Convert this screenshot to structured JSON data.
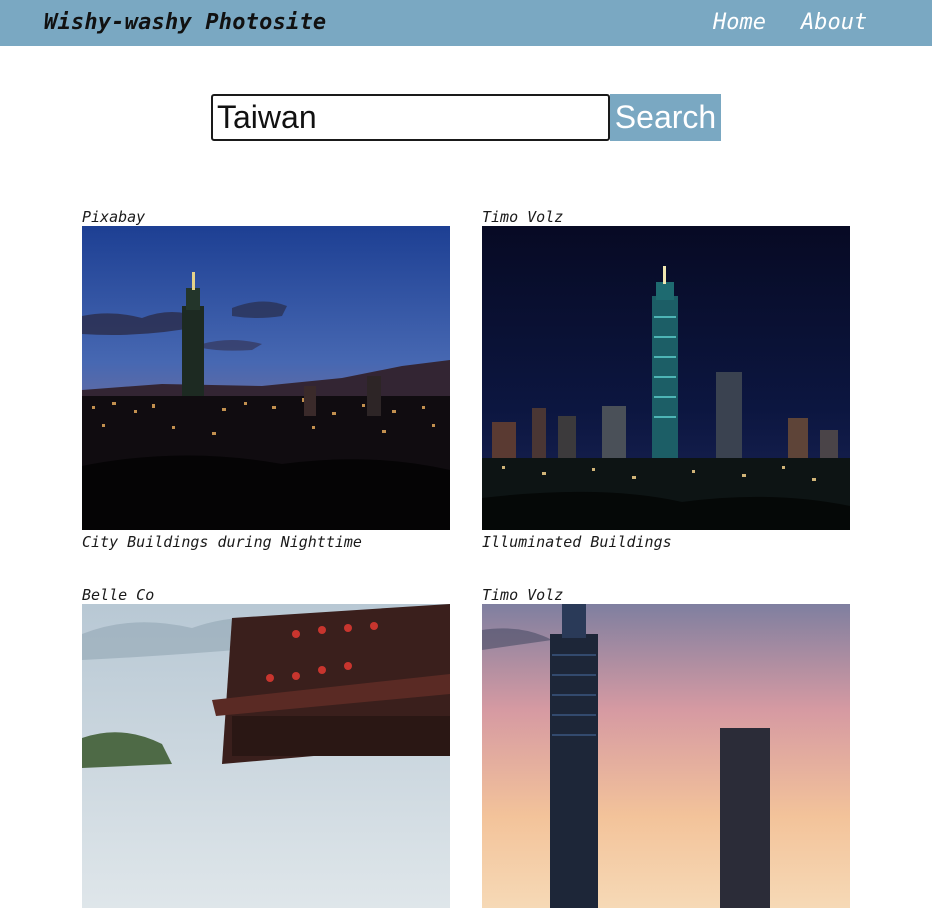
{
  "header": {
    "title": "Wishy-washy Photosite",
    "nav": {
      "home": "Home",
      "about": "About"
    }
  },
  "search": {
    "value": "Taiwan",
    "button_label": "Search"
  },
  "results": [
    {
      "author": "Pixabay",
      "caption": "City Buildings during Nighttime"
    },
    {
      "author": "Timo Volz",
      "caption": "Illuminated Buildings"
    },
    {
      "author": "Belle Co",
      "caption": ""
    },
    {
      "author": "Timo Volz",
      "caption": ""
    }
  ],
  "colors": {
    "accent": "#7aa8c2",
    "nav_text": "#ffffff",
    "title_text": "#111111"
  }
}
